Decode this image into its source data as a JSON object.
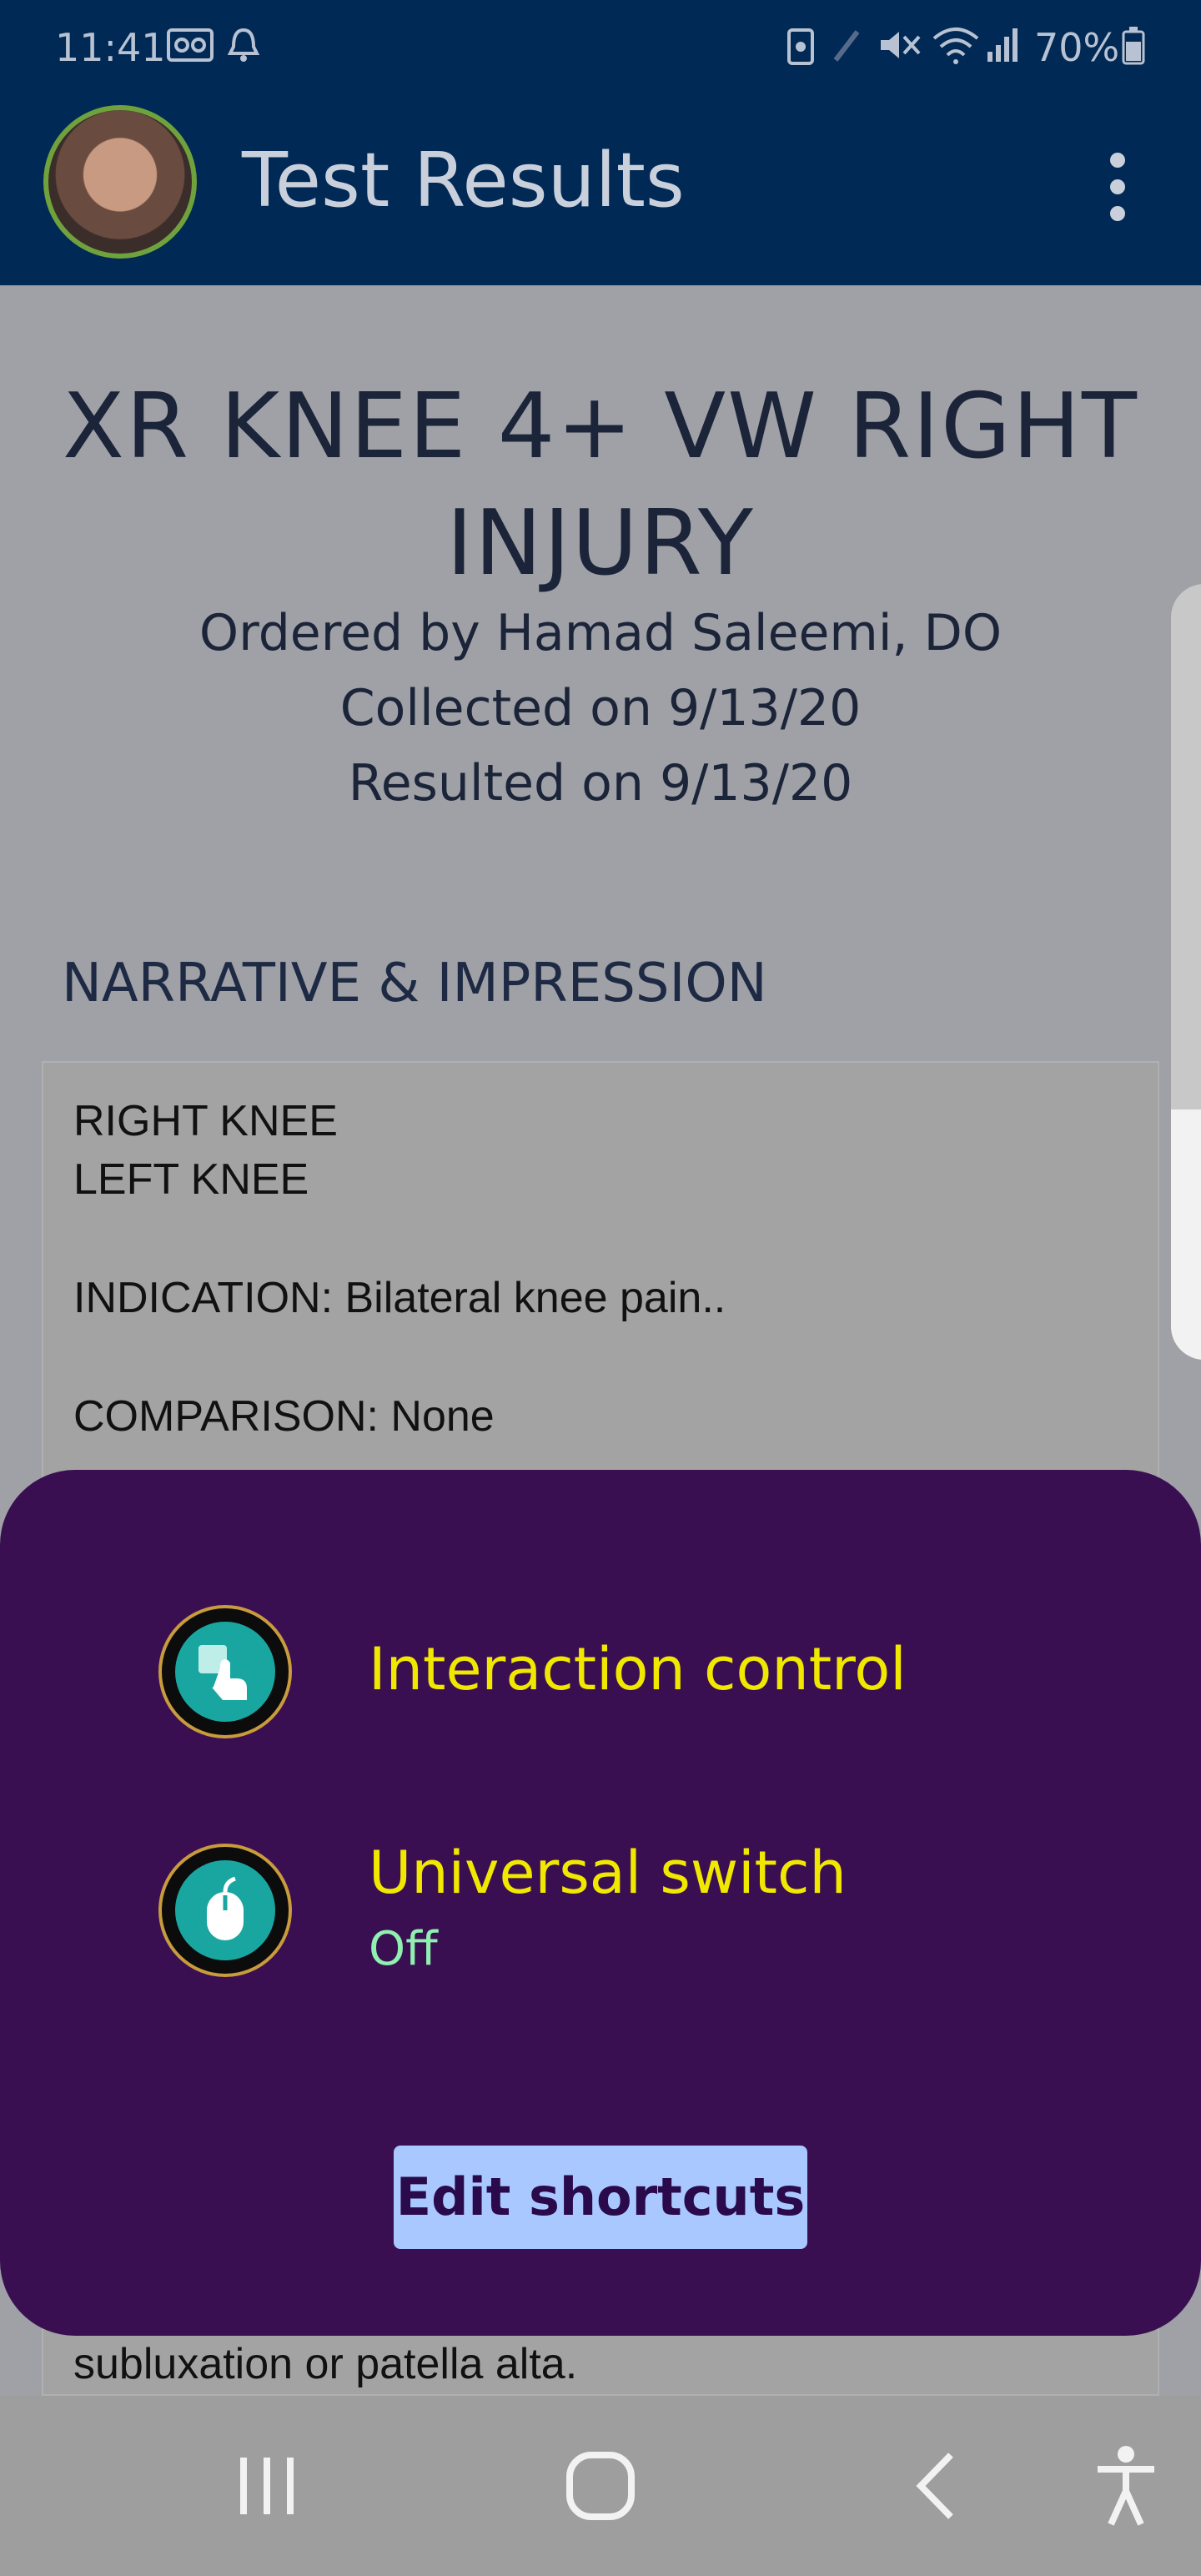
{
  "status_bar": {
    "time": "11:41",
    "battery": "70%"
  },
  "app_bar": {
    "title": "Test Results"
  },
  "report": {
    "title": "XR KNEE 4+ VW RIGHT INJURY",
    "ordered_by": "Ordered by Hamad Saleemi, DO",
    "collected": "Collected on 9/13/20",
    "resulted": "Resulted on 9/13/20",
    "section_heading": "NARRATIVE & IMPRESSION",
    "narrative_lines": [
      "RIGHT KNEE",
      "LEFT KNEE",
      "INDICATION:   Bilateral knee pain..",
      "COMPARISON:  None",
      "subluxation or patella alta."
    ]
  },
  "popup": {
    "shortcuts": [
      {
        "label": "Interaction control",
        "status": ""
      },
      {
        "label": "Universal switch",
        "status": "Off"
      }
    ],
    "edit_button": "Edit shortcuts"
  },
  "colors": {
    "app_bar": "#002955",
    "popup_bg": "#3a0f52",
    "shortcut_label": "#f1e800",
    "shortcut_status": "#8ff0b0",
    "edit_button_bg": "#a9c8ff"
  },
  "icons": {
    "status": [
      "voicemail-icon",
      "alarm-icon",
      "battery-saver-icon",
      "pen-icon",
      "mute-icon",
      "wifi-icon",
      "signal-icon",
      "battery-icon"
    ],
    "app_bar": [
      "avatar",
      "more-vert-icon"
    ],
    "shortcuts": [
      "interaction-control-icon",
      "universal-switch-icon"
    ],
    "nav": [
      "recents-icon",
      "home-icon",
      "back-icon",
      "accessibility-icon"
    ]
  }
}
